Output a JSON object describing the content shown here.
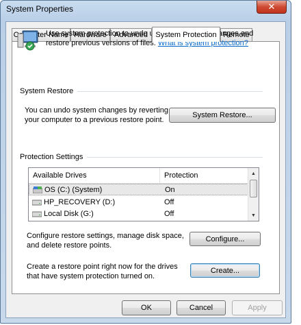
{
  "window": {
    "title": "System Properties",
    "close_glyph": "✕"
  },
  "tabs": [
    {
      "label": "Computer Name"
    },
    {
      "label": "Hardware"
    },
    {
      "label": "Advanced"
    },
    {
      "label": "System Protection"
    },
    {
      "label": "Remote"
    }
  ],
  "active_tab": "System Protection",
  "intro": {
    "text": "Use system protection to undo unwanted system changes and restore previous versions of files.",
    "link": "What is system protection?"
  },
  "system_restore": {
    "header": "System Restore",
    "description": "You can undo system changes by reverting your computer to a previous restore point.",
    "button_label": "System Restore..."
  },
  "protection_settings": {
    "header": "Protection Settings",
    "columns": [
      "Available Drives",
      "Protection"
    ],
    "drives": [
      {
        "name": "OS (C:) (System)",
        "protection": "On",
        "icon": "system-drive-icon"
      },
      {
        "name": "HP_RECOVERY (D:)",
        "protection": "Off",
        "icon": "drive-icon"
      },
      {
        "name": "Local Disk (G:)",
        "protection": "Off",
        "icon": "drive-icon"
      }
    ],
    "configure_text": "Configure restore settings, manage disk space, and delete restore points.",
    "configure_button": "Configure...",
    "create_text": "Create a restore point right now for the drives that have system protection turned on.",
    "create_button": "Create..."
  },
  "footer": {
    "ok": "OK",
    "cancel": "Cancel",
    "apply": "Apply"
  },
  "colors": {
    "link": "#0066cc",
    "close": "#c0331c"
  }
}
